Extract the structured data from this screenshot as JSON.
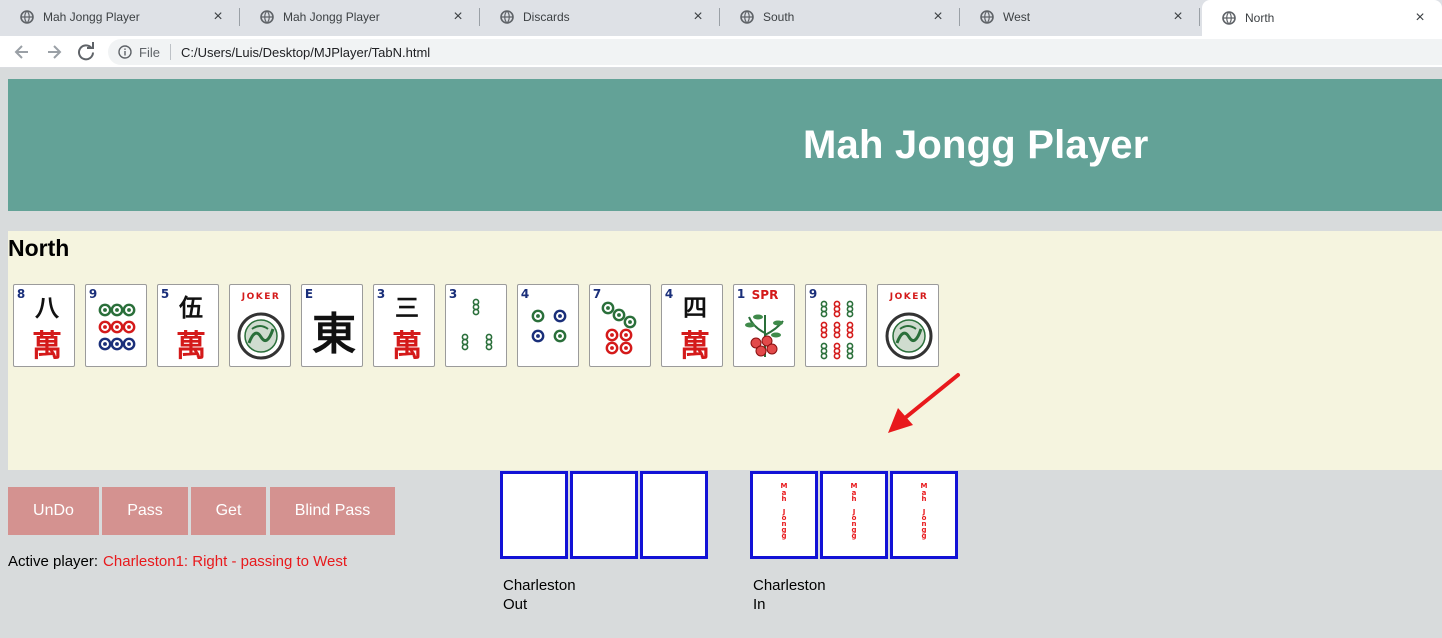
{
  "browser": {
    "tabs": [
      {
        "title": "Mah Jongg Player",
        "active": false
      },
      {
        "title": "Mah Jongg Player",
        "active": false
      },
      {
        "title": "Discards",
        "active": false
      },
      {
        "title": "South",
        "active": false
      },
      {
        "title": "West",
        "active": false
      },
      {
        "title": "North",
        "active": true
      }
    ],
    "address": {
      "scheme_label": "File",
      "url": "C:/Users/Luis/Desktop/MJPlayer/TabN.html"
    }
  },
  "page": {
    "title": "Mah Jongg Player",
    "player_name": "North",
    "hand": [
      {
        "suit": "crack",
        "rank": "8",
        "glyph": "八"
      },
      {
        "suit": "dot",
        "rank": "9"
      },
      {
        "suit": "crack",
        "rank": "5",
        "glyph": "伍"
      },
      {
        "suit": "joker",
        "label": "JOKER"
      },
      {
        "suit": "wind",
        "rank": "E",
        "glyph": "東"
      },
      {
        "suit": "crack",
        "rank": "3",
        "glyph": "三"
      },
      {
        "suit": "bam",
        "rank": "3"
      },
      {
        "suit": "dot",
        "rank": "4"
      },
      {
        "suit": "dot",
        "rank": "7"
      },
      {
        "suit": "crack",
        "rank": "4",
        "glyph": "四"
      },
      {
        "suit": "flower",
        "rank": "1",
        "label": "SPR"
      },
      {
        "suit": "bam",
        "rank": "9"
      },
      {
        "suit": "joker",
        "label": "JOKER"
      }
    ],
    "crack_glyph": "萬",
    "buttons": {
      "undo": "UnDo",
      "pass": "Pass",
      "get": "Get",
      "blind_pass": "Blind Pass"
    },
    "status": {
      "label": "Active player:",
      "value": "Charleston1:  Right - passing to West"
    },
    "charleston_out": {
      "label_line1": "Charleston",
      "label_line2": "Out",
      "slots": [
        "empty",
        "empty",
        "empty"
      ]
    },
    "charleston_in": {
      "label_line1": "Charleston",
      "label_line2": "In",
      "slots": [
        "tile-back",
        "tile-back",
        "tile-back"
      ],
      "back_text": "Mah Jongg"
    },
    "colors": {
      "header": "#63a297",
      "hand_bg": "#f5f4df",
      "button": "#d49290",
      "slot_border": "#1212d6",
      "status_value": "#e8191c",
      "arrow": "#e8191c"
    }
  }
}
